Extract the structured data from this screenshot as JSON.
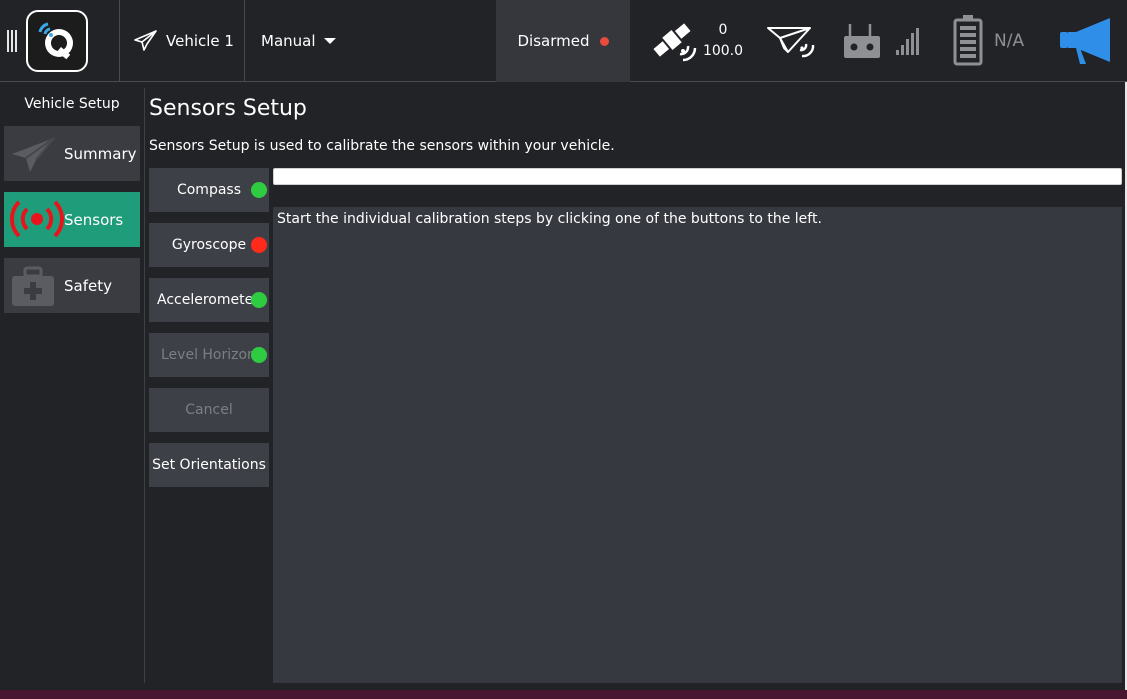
{
  "toolbar": {
    "vehicle_label": "Vehicle 1",
    "mode_label": "Manual",
    "arm_status": "Disarmed",
    "gps_count": "0",
    "gps_hdop": "100.0",
    "battery_text": "N/A"
  },
  "sidebar": {
    "title": "Vehicle Setup",
    "items": [
      {
        "label": "Summary",
        "icon": "paper-plane-icon",
        "active": false
      },
      {
        "label": "Sensors",
        "icon": "sensors-icon",
        "active": true
      },
      {
        "label": "Safety",
        "icon": "first-aid-kit-icon",
        "active": false
      }
    ]
  },
  "main": {
    "title": "Sensors Setup",
    "description": "Sensors Setup is used to calibrate the sensors within your vehicle.",
    "buttons": [
      {
        "label": "Compass",
        "status": "ok",
        "enabled": true
      },
      {
        "label": "Gyroscope",
        "status": "error",
        "enabled": true
      },
      {
        "label": "Accelerometer",
        "status": "ok",
        "enabled": true
      },
      {
        "label": "Level Horizon",
        "status": "ok",
        "enabled": false
      },
      {
        "label": "Cancel",
        "status": "none",
        "enabled": false
      },
      {
        "label": "Set Orientations",
        "status": "none",
        "enabled": true
      }
    ],
    "progress": 0,
    "message": "Start the individual calibration steps by clicking one of the buttons to the left."
  },
  "colors": {
    "accent": "#1f9c79",
    "status_ok": "#2ecc40",
    "status_error": "#ff2a1a",
    "armed_dot": "#e74c3c",
    "announce_blue": "#2f8fe8"
  }
}
